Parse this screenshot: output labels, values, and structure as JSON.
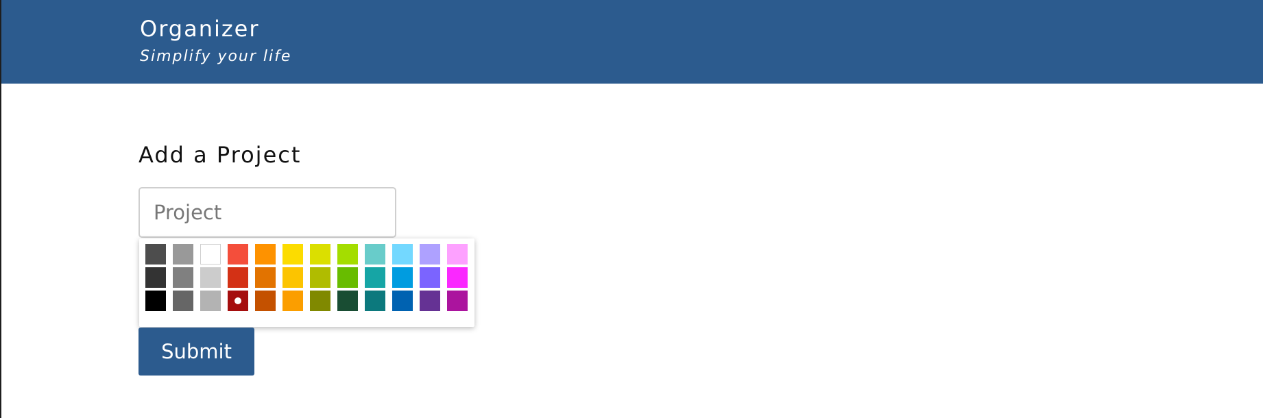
{
  "header": {
    "title": "Organizer",
    "tagline": "Simplify your life",
    "background_color": "#2c5b8e"
  },
  "form": {
    "title": "Add a Project",
    "project_input": {
      "value": "",
      "placeholder": "Project"
    },
    "color_palette": {
      "selected_color": "#a50e0e",
      "rows": [
        [
          "#4d4d4d",
          "#999999",
          "#ffffff",
          "#f44e3b",
          "#fe9200",
          "#fcdc00",
          "#dbdf00",
          "#a4dd00",
          "#68ccca",
          "#73d8ff",
          "#aea1ff",
          "#fda1ff"
        ],
        [
          "#333333",
          "#808080",
          "#cccccc",
          "#d33115",
          "#e27300",
          "#fcc400",
          "#b0bc00",
          "#68bc00",
          "#16a5a5",
          "#009ce0",
          "#7b64ff",
          "#fa28ff"
        ],
        [
          "#000000",
          "#666666",
          "#b3b3b3",
          "#a50e0e",
          "#c45100",
          "#fb9e00",
          "#808900",
          "#194d33",
          "#0c797d",
          "#0062b1",
          "#653294",
          "#ab149e"
        ]
      ]
    },
    "submit_label": "Submit"
  }
}
